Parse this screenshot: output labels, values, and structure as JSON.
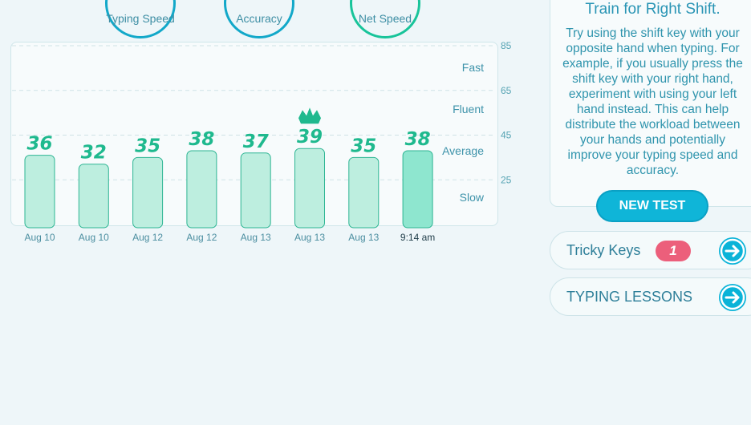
{
  "gauges": [
    {
      "label": "Typing Speed"
    },
    {
      "label": "Accuracy"
    },
    {
      "label": "Net Speed"
    }
  ],
  "chart_data": {
    "type": "bar",
    "categories": [
      "Aug 10",
      "Aug 10",
      "Aug 12",
      "Aug 12",
      "Aug 13",
      "Aug 13",
      "Aug 13",
      "9:14 am"
    ],
    "values": [
      36,
      32,
      35,
      38,
      37,
      39,
      35,
      38
    ],
    "ylim": [
      5,
      85
    ],
    "yticks": [
      85,
      65,
      45,
      25
    ],
    "zones": [
      "Fast",
      "Fluent",
      "Average",
      "Slow"
    ],
    "best_index": 5,
    "grid": true
  },
  "tip": {
    "title": "Train for Right Shift.",
    "text": "Try using the shift key with your opposite hand when typing. For example, if you usually press the shift key with your right hand, experiment with using your left hand instead. This can help distribute the workload between your hands and potentially improve your typing speed and accuracy."
  },
  "new_test_label": "NEW TEST",
  "tricky_keys": {
    "label": "Tricky Keys",
    "count": "1"
  },
  "typing_lessons_label": "TYPING LESSONS",
  "colors": {
    "accent": "#0fb5d8",
    "bar": "#bdeedf",
    "value": "#1fb98e",
    "badge": "#ec5f7b"
  }
}
